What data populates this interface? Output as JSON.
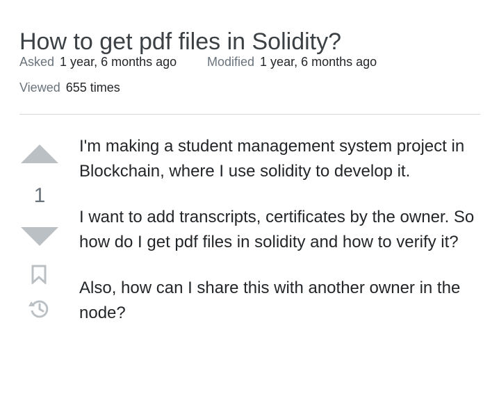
{
  "question": {
    "title": "How to get pdf files in Solidity?",
    "asked_label": "Asked",
    "asked_value": "1 year, 6 months ago",
    "modified_label": "Modified",
    "modified_value": "1 year, 6 months ago",
    "viewed_label": "Viewed",
    "viewed_value": "655 times",
    "score": "1",
    "body": [
      "I'm making a student management system project in Blockchain, where I use solidity to develop it.",
      "I want to add transcripts, certificates by the owner. So how do I get pdf files in solidity and how to verify it?",
      "Also, how can I share this with another owner in the node?"
    ]
  },
  "icons": {
    "upvote": "upvote-arrow-icon",
    "downvote": "downvote-arrow-icon",
    "bookmark": "bookmark-icon",
    "history": "history-icon"
  },
  "colors": {
    "vote_arrow": "#bbc0c4",
    "label": "#6a737c",
    "text": "#232629",
    "divider": "#d6d9dc"
  }
}
